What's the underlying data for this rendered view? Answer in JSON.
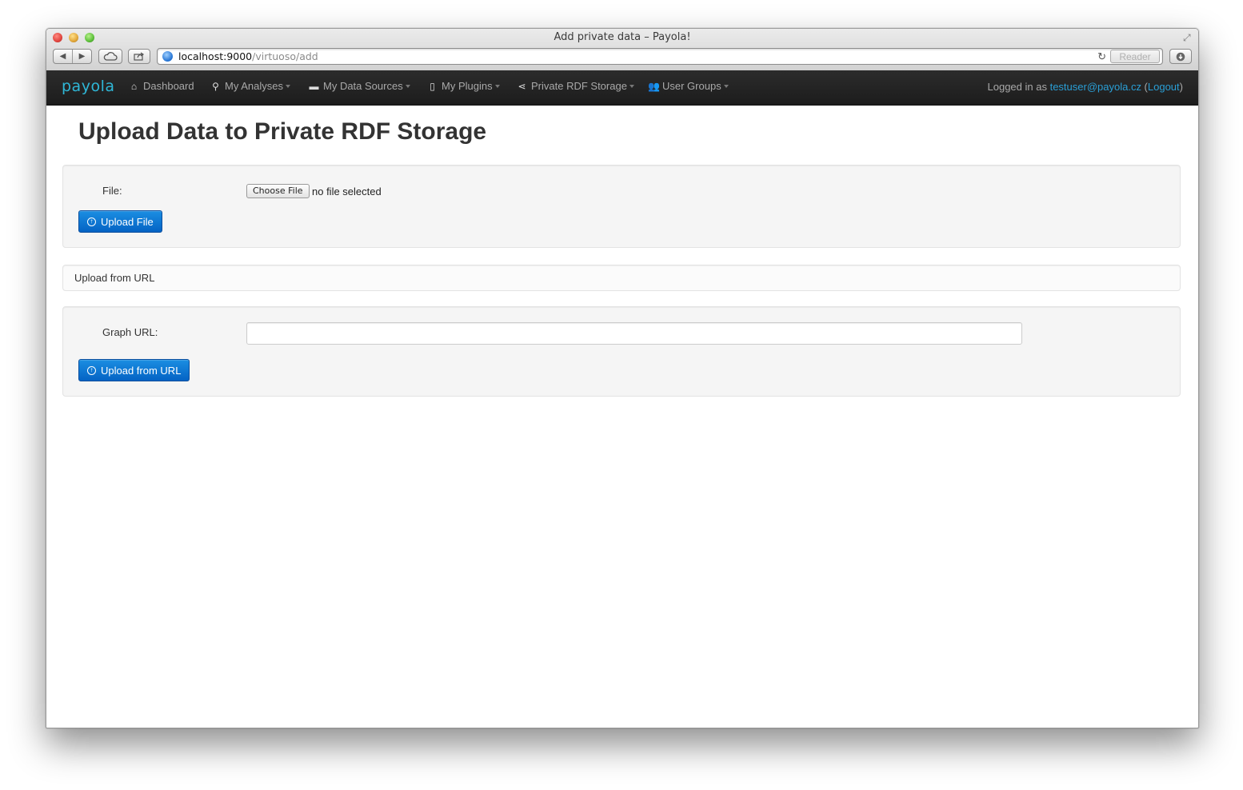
{
  "window": {
    "title": "Add private data – Payola!"
  },
  "address_bar": {
    "host": "localhost:9000",
    "path": "/virtuoso/add",
    "reader_label": "Reader"
  },
  "navbar": {
    "brand": "payola",
    "items": [
      {
        "label": "Dashboard",
        "icon": "home-icon",
        "dropdown": false
      },
      {
        "label": "My Analyses",
        "icon": "search-icon",
        "dropdown": true
      },
      {
        "label": "My Data Sources",
        "icon": "hdd-icon",
        "dropdown": true
      },
      {
        "label": "My Plugins",
        "icon": "file-icon",
        "dropdown": true
      },
      {
        "label": "Private RDF Storage",
        "icon": "share-icon",
        "dropdown": true
      },
      {
        "label": "User Groups",
        "icon": "group-icon",
        "dropdown": true
      }
    ],
    "logged_prefix": "Logged in as ",
    "user_email": "testuser@payola.cz",
    "logout_label": "Logout"
  },
  "page": {
    "title": "Upload Data to Private RDF Storage",
    "file_label": "File:",
    "choose_file_label": "Choose File",
    "file_status": "no file selected",
    "upload_file_label": "Upload File",
    "url_section_header": "Upload from URL",
    "graph_url_label": "Graph URL:",
    "graph_url_value": "",
    "upload_url_label": "Upload from URL"
  }
}
